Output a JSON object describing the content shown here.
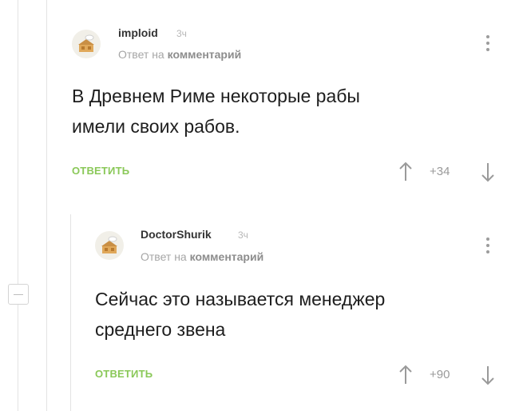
{
  "comments": [
    {
      "username": "imploid",
      "time": "3ч",
      "reply_prefix": "Ответ на",
      "reply_target": "комментарий",
      "body_line1": "В Древнем Риме некоторые рабы",
      "body_line2": "имели своих рабов.",
      "reply_label": "ОТВЕТИТЬ",
      "rating": "+34"
    },
    {
      "username": "DoctorShurik",
      "time": "3ч",
      "reply_prefix": "Ответ на",
      "reply_target": "комментарий",
      "body_line1": "Сейчас это называется менеджер",
      "body_line2": "среднего звена",
      "reply_label": "ОТВЕТИТЬ",
      "rating": "+90"
    }
  ],
  "colors": {
    "accent": "#8ac858",
    "muted": "#a6a6a6",
    "line": "#e3e3e3"
  },
  "icons": [
    "avatar-icon",
    "more-icon",
    "upvote-icon",
    "downvote-icon",
    "collapse-icon"
  ]
}
